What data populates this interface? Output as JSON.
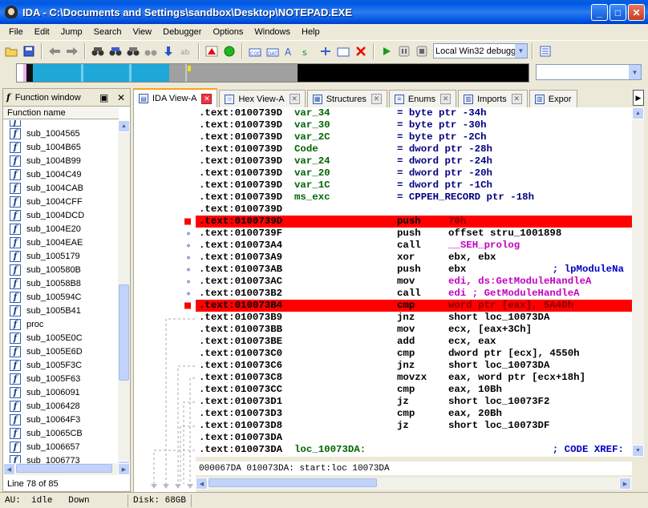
{
  "window": {
    "title": "IDA - C:\\Documents and Settings\\sandbox\\Desktop\\NOTEPAD.EXE",
    "minimize": "_",
    "maximize": "□",
    "close": "✕"
  },
  "menu": [
    "File",
    "Edit",
    "Jump",
    "Search",
    "View",
    "Debugger",
    "Options",
    "Windows",
    "Help"
  ],
  "toolbar": {
    "debugger_select": "Local Win32 debugge"
  },
  "functions_window": {
    "title": "Function window",
    "column_header": "Function name",
    "items": [
      "sub_1004565",
      "sub_1004B65",
      "sub_1004B99",
      "sub_1004C49",
      "sub_1004CAB",
      "sub_1004CFF",
      "sub_1004DCD",
      "sub_1004E20",
      "sub_1004EAE",
      "sub_1005179",
      "sub_100580B",
      "sub_10058B8",
      "sub_100594C",
      "sub_1005B41",
      "proc",
      "sub_1005E0C",
      "sub_1005E6D",
      "sub_1005F3C",
      "sub_1005F63",
      "sub_1006091",
      "sub_1006428",
      "sub_10064F3",
      "sub_10065CB",
      "sub_1006657",
      "sub_1006773"
    ],
    "line_status": "Line 78 of 85"
  },
  "tabs": [
    {
      "label": "IDA View-A",
      "active": true,
      "icon": "ida-view-icon"
    },
    {
      "label": "Hex View-A",
      "active": false,
      "icon": "hex-view-icon"
    },
    {
      "label": "Structures",
      "active": false,
      "icon": "structures-icon"
    },
    {
      "label": "Enums",
      "active": false,
      "icon": "enums-icon"
    },
    {
      "label": "Imports",
      "active": false,
      "icon": "imports-icon"
    },
    {
      "label": "Expor",
      "active": false,
      "icon": "exports-icon"
    }
  ],
  "disasm": [
    {
      "addr": ".text:0100739D",
      "label": "var_34",
      "mnem": "= byte ptr -34h",
      "ops": "",
      "cmt": "",
      "bp": false
    },
    {
      "addr": ".text:0100739D",
      "label": "var_30",
      "mnem": "= byte ptr -30h",
      "ops": "",
      "cmt": "",
      "bp": false
    },
    {
      "addr": ".text:0100739D",
      "label": "var_2C",
      "mnem": "= byte ptr -2Ch",
      "ops": "",
      "cmt": "",
      "bp": false
    },
    {
      "addr": ".text:0100739D",
      "label": "Code",
      "mnem": "= dword ptr -28h",
      "ops": "",
      "cmt": "",
      "bp": false
    },
    {
      "addr": ".text:0100739D",
      "label": "var_24",
      "mnem": "= dword ptr -24h",
      "ops": "",
      "cmt": "",
      "bp": false
    },
    {
      "addr": ".text:0100739D",
      "label": "var_20",
      "mnem": "= dword ptr -20h",
      "ops": "",
      "cmt": "",
      "bp": false
    },
    {
      "addr": ".text:0100739D",
      "label": "var_1C",
      "mnem": "= dword ptr -1Ch",
      "ops": "",
      "cmt": "",
      "bp": false
    },
    {
      "addr": ".text:0100739D",
      "label": "ms_exc",
      "mnem": "= CPPEH_RECORD ptr -18h",
      "ops": "",
      "cmt": "",
      "bp": false
    },
    {
      "addr": ".text:0100739D",
      "label": "",
      "mnem": "",
      "ops": "",
      "cmt": "",
      "bp": false
    },
    {
      "addr": ".text:0100739D",
      "label": "",
      "mnem": "push",
      "ops": "70h",
      "cmt": "",
      "bp": true
    },
    {
      "addr": ".text:0100739F",
      "label": "",
      "mnem": "push",
      "ops": "offset stru_1001898",
      "cmt": "",
      "bp": false
    },
    {
      "addr": ".text:010073A4",
      "label": "",
      "mnem": "call",
      "ops": "__SEH_prolog",
      "cmt": "",
      "bp": false
    },
    {
      "addr": ".text:010073A9",
      "label": "",
      "mnem": "xor",
      "ops": "ebx, ebx",
      "cmt": "",
      "bp": false
    },
    {
      "addr": ".text:010073AB",
      "label": "",
      "mnem": "push",
      "ops": "ebx",
      "cmt": "; lpModuleNa",
      "bp": false
    },
    {
      "addr": ".text:010073AC",
      "label": "",
      "mnem": "mov",
      "ops": "edi, ds:GetModuleHandleA",
      "cmt": "",
      "bp": false
    },
    {
      "addr": ".text:010073B2",
      "label": "",
      "mnem": "call",
      "ops": "edi ; GetModuleHandleA",
      "cmt": "",
      "bp": false
    },
    {
      "addr": ".text:010073B4",
      "label": "",
      "mnem": "cmp",
      "ops": "word ptr [eax], 5A4Dh",
      "cmt": "",
      "bp": true
    },
    {
      "addr": ".text:010073B9",
      "label": "",
      "mnem": "jnz",
      "ops": "short loc_10073DA",
      "cmt": "",
      "bp": false
    },
    {
      "addr": ".text:010073BB",
      "label": "",
      "mnem": "mov",
      "ops": "ecx, [eax+3Ch]",
      "cmt": "",
      "bp": false
    },
    {
      "addr": ".text:010073BE",
      "label": "",
      "mnem": "add",
      "ops": "ecx, eax",
      "cmt": "",
      "bp": false
    },
    {
      "addr": ".text:010073C0",
      "label": "",
      "mnem": "cmp",
      "ops": "dword ptr [ecx], 4550h",
      "cmt": "",
      "bp": false
    },
    {
      "addr": ".text:010073C6",
      "label": "",
      "mnem": "jnz",
      "ops": "short loc_10073DA",
      "cmt": "",
      "bp": false
    },
    {
      "addr": ".text:010073C8",
      "label": "",
      "mnem": "movzx",
      "ops": "eax, word ptr [ecx+18h]",
      "cmt": "",
      "bp": false
    },
    {
      "addr": ".text:010073CC",
      "label": "",
      "mnem": "cmp",
      "ops": "eax, 10Bh",
      "cmt": "",
      "bp": false
    },
    {
      "addr": ".text:010073D1",
      "label": "",
      "mnem": "jz",
      "ops": "short loc_10073F2",
      "cmt": "",
      "bp": false
    },
    {
      "addr": ".text:010073D3",
      "label": "",
      "mnem": "cmp",
      "ops": "eax, 20Bh",
      "cmt": "",
      "bp": false
    },
    {
      "addr": ".text:010073D8",
      "label": "",
      "mnem": "jz",
      "ops": "short loc_10073DF",
      "cmt": "",
      "bp": false
    },
    {
      "addr": ".text:010073DA",
      "label": "",
      "mnem": "",
      "ops": "",
      "cmt": "",
      "bp": false
    },
    {
      "addr": ".text:010073DA",
      "label": "loc_10073DA:",
      "mnem": "",
      "ops": "",
      "cmt": "; CODE XREF:",
      "bp": false
    }
  ],
  "disasm_status": "000067DA 010073DA: start:loc 10073DA",
  "statusbar": {
    "au_label": "AU:",
    "au_value": "idle",
    "direction": "Down",
    "disk": "Disk: 68GB"
  },
  "colors": {
    "breakpoint": "#ff0000",
    "name": "#006400",
    "import": "#ff00ff"
  }
}
